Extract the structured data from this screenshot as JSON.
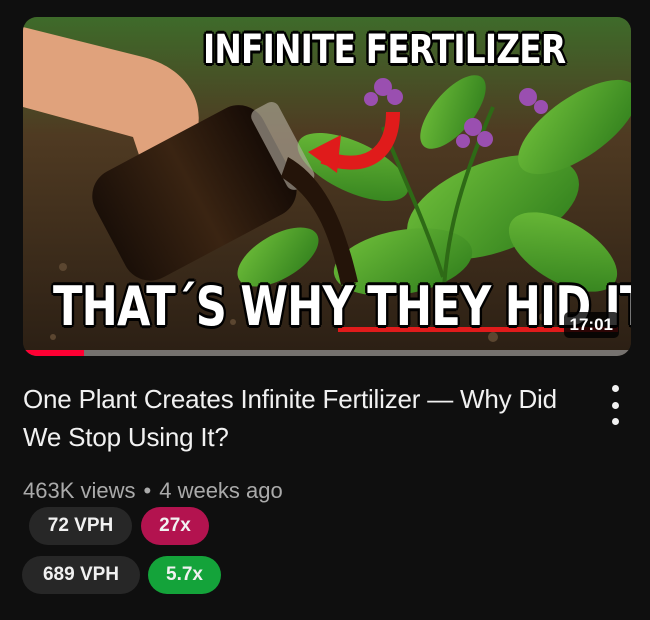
{
  "thumbnail": {
    "headline_top": "INFINITE FERTILIZER",
    "headline_bottom": "THAT´S WHY THEY HID IT",
    "duration": "17:01",
    "watch_progress": 0.1
  },
  "video": {
    "title": "One Plant Creates Infinite Fertilizer — Why Did We Stop Using It?",
    "views": "463K views",
    "separator": "•",
    "age": "4 weeks ago"
  },
  "stats": [
    {
      "vph": "72 VPH",
      "multiplier": "27x",
      "multiplier_color": "#b3134f"
    },
    {
      "vph": "689 VPH",
      "multiplier": "5.7x",
      "multiplier_color": "#14a33a"
    }
  ],
  "menu_icon": "more-vertical-icon"
}
